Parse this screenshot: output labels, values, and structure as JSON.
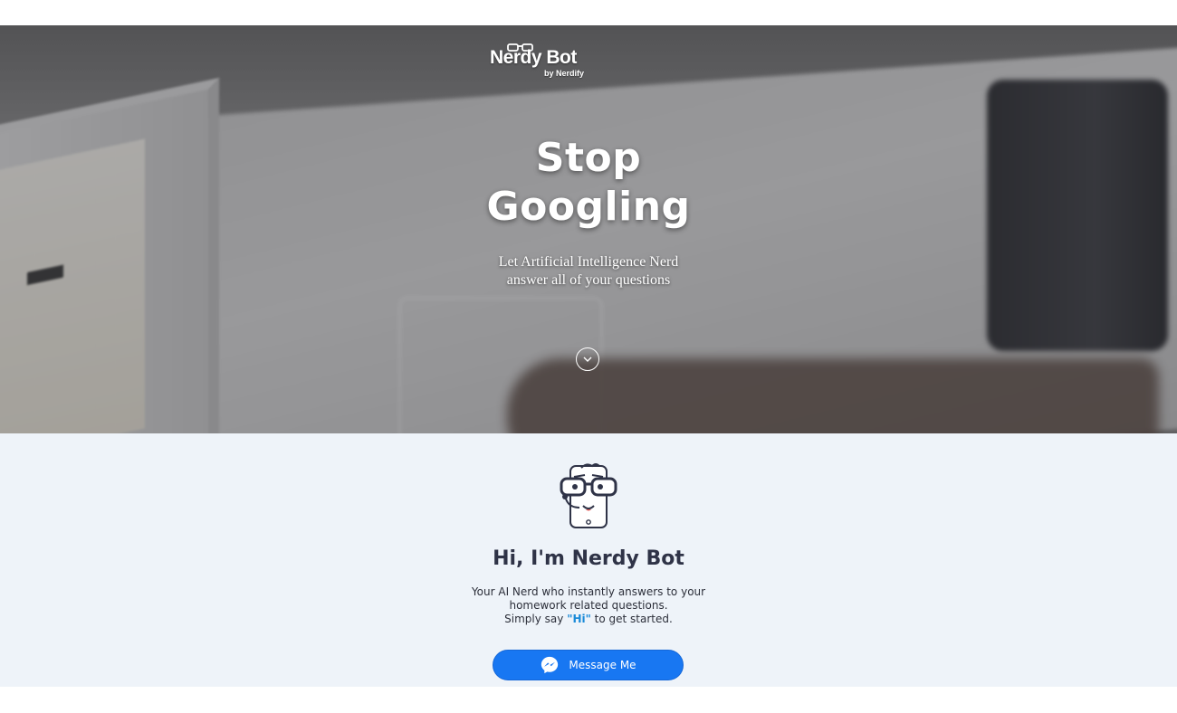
{
  "header": {
    "logo_text": "Nerdy Bot",
    "logo_subtext": "by Nerdify"
  },
  "hero": {
    "title_line1": "Stop",
    "title_line2": "Googling",
    "subtitle_line1": "Let Artificial Intelligence Nerd",
    "subtitle_line2": "answer all of your questions",
    "scroll_icon": "chevron-down-icon"
  },
  "intro": {
    "avatar_icon": "nerdy-bot-avatar-icon",
    "title": "Hi, I'm Nerdy Bot",
    "text_line1": "Your AI Nerd who instantly answers to your",
    "text_line2": "homework related questions.",
    "text_line3_prefix": "Simply say ",
    "text_line3_highlight": "\"Hi\"",
    "text_line3_suffix": " to get started.",
    "button_label": "Message Me",
    "button_icon": "messenger-icon"
  },
  "colors": {
    "accent": "#1877f2",
    "highlight": "#1a8ad8",
    "intro_bg": "#eef3f9",
    "title": "#2f3347"
  }
}
